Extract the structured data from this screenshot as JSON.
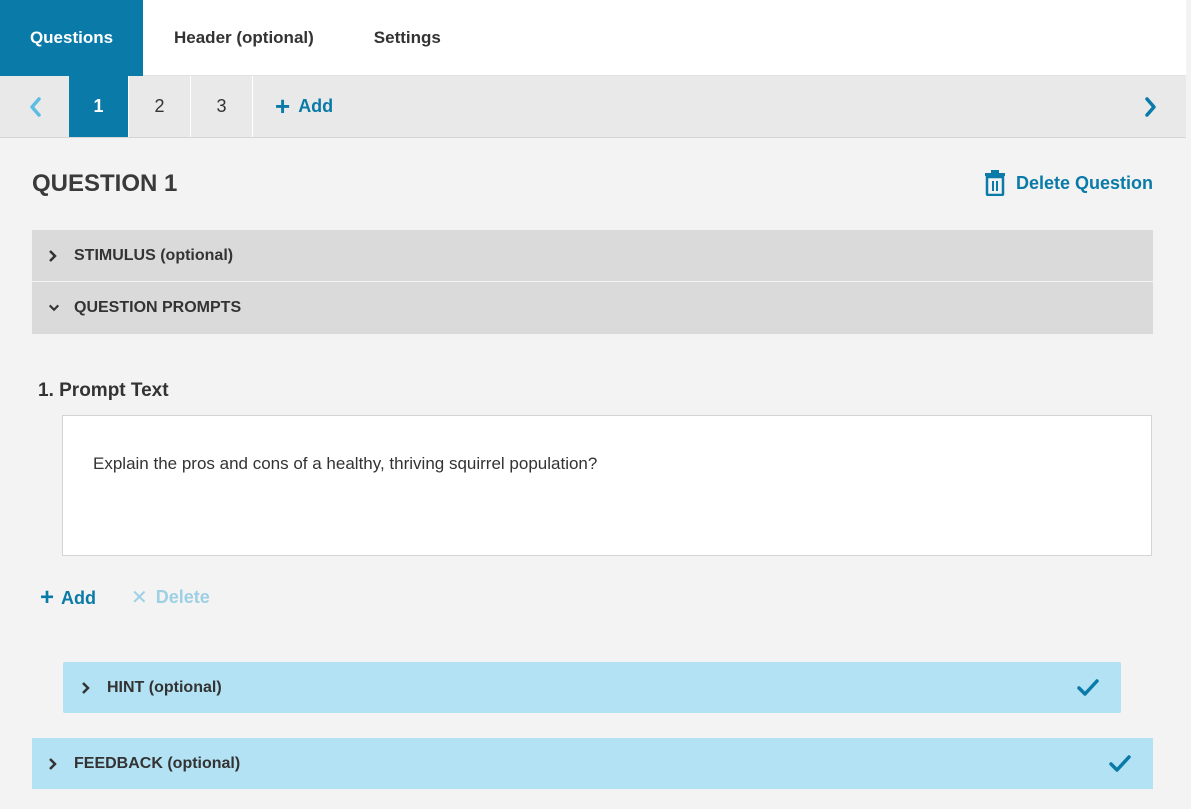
{
  "top_tabs": {
    "questions": "Questions",
    "header": "Header (optional)",
    "settings": "Settings"
  },
  "question_nav": {
    "numbers": [
      "1",
      "2",
      "3"
    ],
    "active": "1",
    "add_label": "Add",
    "add_icon": "+"
  },
  "question": {
    "title": "QUESTION 1",
    "delete_label": "Delete Question"
  },
  "sections": {
    "stimulus": "STIMULUS (optional)",
    "prompts": "QUESTION PROMPTS",
    "hint": "HINT (optional)",
    "feedback": "FEEDBACK (optional)"
  },
  "prompt": {
    "label": "1. Prompt Text",
    "text": "Explain the pros and cons of a healthy, thriving squirrel population?"
  },
  "actions": {
    "add_label": "Add",
    "add_icon": "+",
    "delete_label": "Delete",
    "delete_icon": "✕"
  },
  "colors": {
    "accent": "#0a7aa8",
    "light_blue": "#b2e2f3",
    "section_gray": "#dadada",
    "disabled_blue": "#9dd0e5"
  },
  "icons": {
    "left_arrow": "chevron-left-icon",
    "right_arrow": "chevron-right-icon",
    "trash": "trash-icon",
    "check": "check-icon"
  }
}
